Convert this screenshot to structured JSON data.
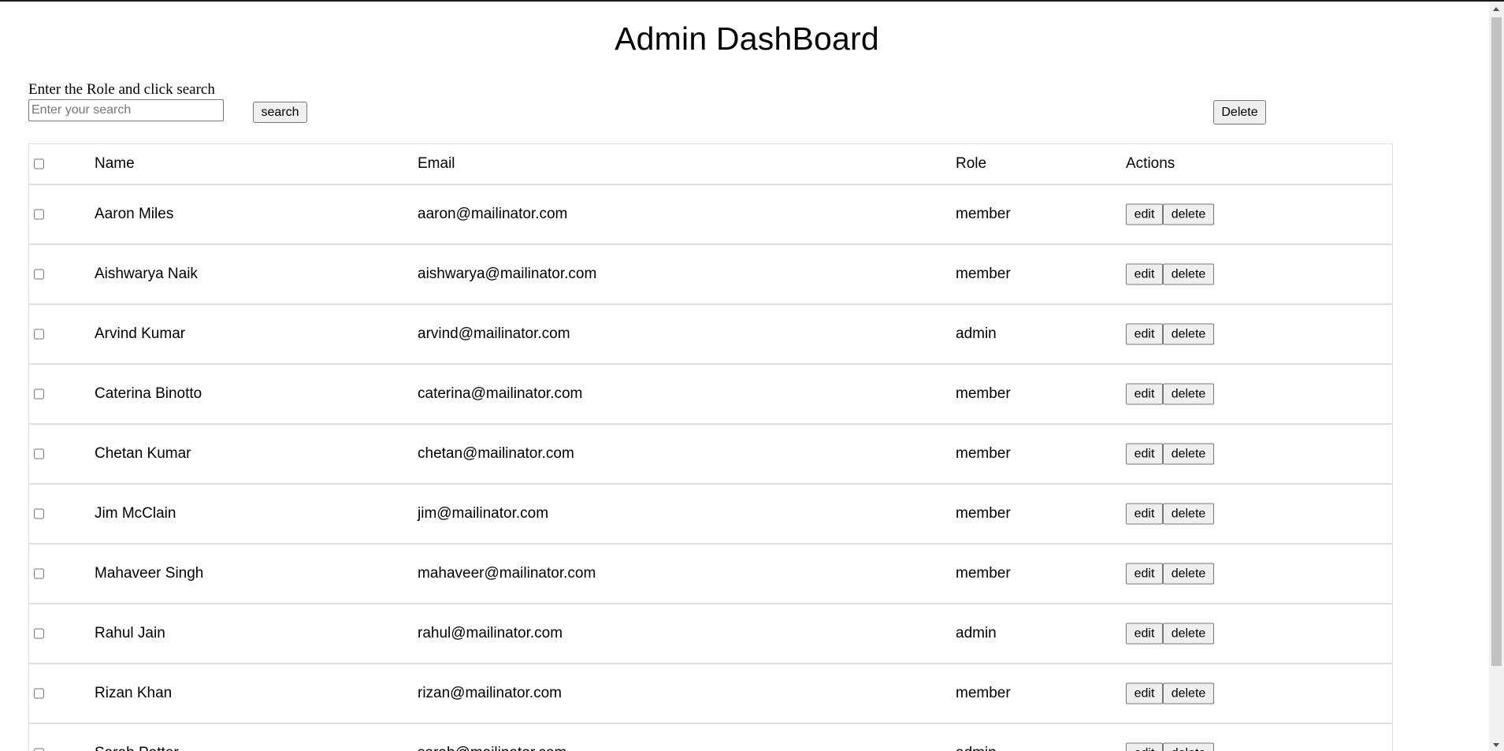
{
  "page": {
    "title": "Admin DashBoard"
  },
  "search": {
    "label": "Enter the Role and click search",
    "placeholder": "Enter your search",
    "value": "",
    "button_label": "search"
  },
  "toolbar": {
    "delete_label": "Delete"
  },
  "table": {
    "columns": [
      "Name",
      "Email",
      "Role",
      "Actions"
    ],
    "header_checked": false,
    "edit_label": "edit",
    "delete_label": "delete",
    "rows": [
      {
        "name": "Aaron Miles",
        "email": "aaron@mailinator.com",
        "role": "member"
      },
      {
        "name": "Aishwarya Naik",
        "email": "aishwarya@mailinator.com",
        "role": "member"
      },
      {
        "name": "Arvind Kumar",
        "email": "arvind@mailinator.com",
        "role": "admin"
      },
      {
        "name": "Caterina Binotto",
        "email": "caterina@mailinator.com",
        "role": "member"
      },
      {
        "name": "Chetan Kumar",
        "email": "chetan@mailinator.com",
        "role": "member"
      },
      {
        "name": "Jim McClain",
        "email": "jim@mailinator.com",
        "role": "member"
      },
      {
        "name": "Mahaveer Singh",
        "email": "mahaveer@mailinator.com",
        "role": "member"
      },
      {
        "name": "Rahul Jain",
        "email": "rahul@mailinator.com",
        "role": "admin"
      },
      {
        "name": "Rizan Khan",
        "email": "rizan@mailinator.com",
        "role": "member"
      },
      {
        "name": "Sarah Potter",
        "email": "sarah@mailinator.com",
        "role": "admin"
      }
    ]
  }
}
